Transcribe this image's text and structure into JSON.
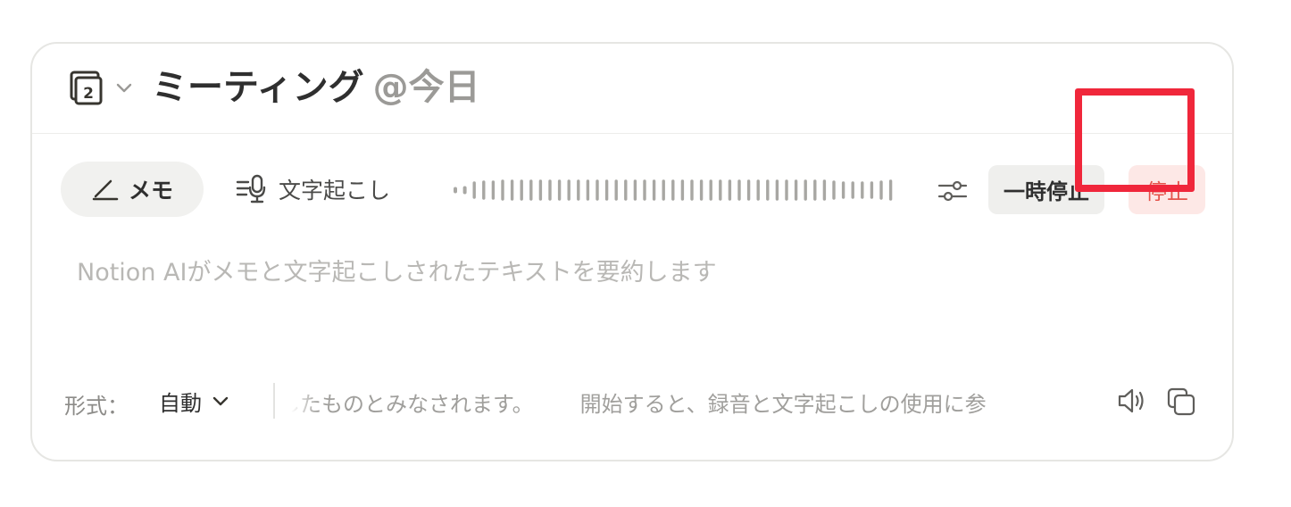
{
  "header": {
    "title": "ミーティング",
    "date_mention": "@今日",
    "calendar_icon": "calendar-icon",
    "calendar_day": "2",
    "chevron_icon": "chevron-down-icon"
  },
  "toolbar": {
    "tabs": [
      {
        "label": "メモ",
        "icon": "pencil-icon",
        "active": true
      },
      {
        "label": "文字起こし",
        "icon": "transcript-mic-icon",
        "active": false
      }
    ],
    "waveform_icon": "waveform-icon",
    "settings_icon": "sliders-icon",
    "pause_label": "一時停止",
    "stop_label": "停止"
  },
  "body": {
    "placeholder": "Notion AIがメモと文字起こしされたテキストを要約します"
  },
  "footer": {
    "format_label": "形式：",
    "format_value": "自動",
    "notice_part1": "したものとみなされます。",
    "notice_part2": "開始すると、録音と文字起こしの使用に参",
    "speaker_icon": "speaker-icon",
    "copy_icon": "copy-icon"
  },
  "colors": {
    "stop_text": "#e5534b",
    "stop_bg": "#fde8e6",
    "highlight": "#f0273b"
  }
}
